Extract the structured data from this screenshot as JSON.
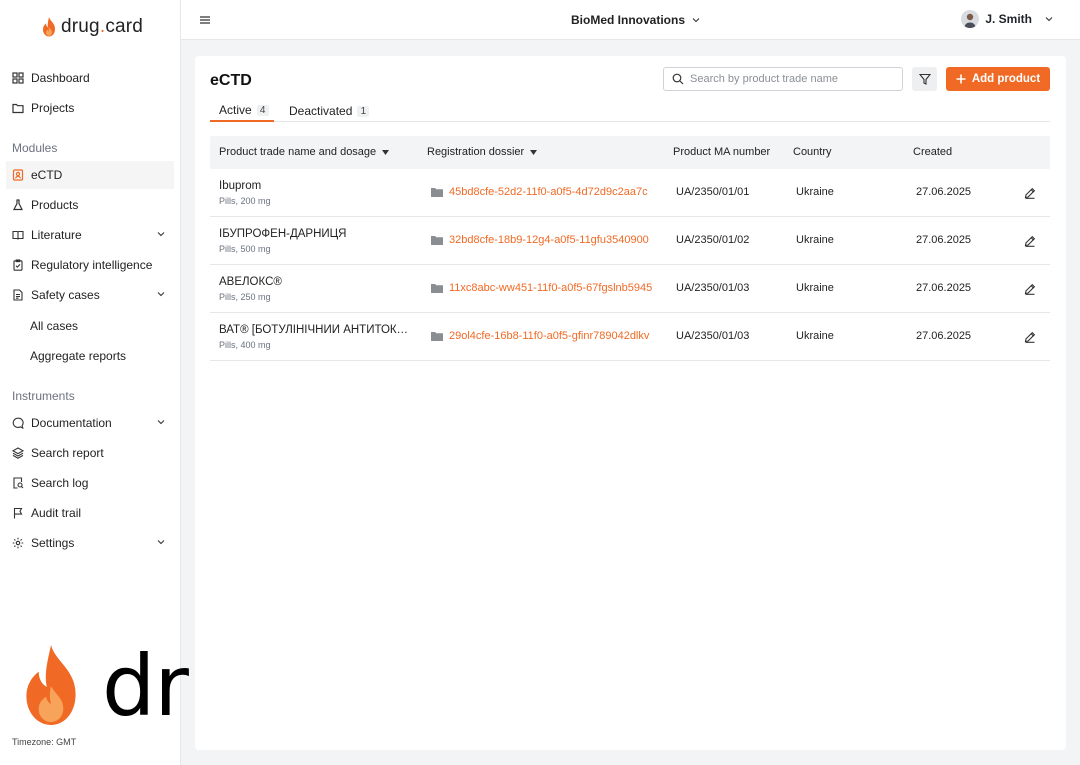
{
  "brand": {
    "name_part1": "drug",
    "name_dot": ".",
    "name_part2": "card",
    "accent": "#f06a25"
  },
  "sidebar": {
    "items": [
      {
        "label": "Dashboard",
        "icon": "grid-icon"
      },
      {
        "label": "Projects",
        "icon": "folder-icon"
      }
    ],
    "modules_label": "Modules",
    "modules": [
      {
        "label": "eCTD",
        "icon": "ectd-icon",
        "active": true
      },
      {
        "label": "Products",
        "icon": "flask-icon"
      },
      {
        "label": "Literature",
        "icon": "book-icon"
      },
      {
        "label": "Regulatory intelligence",
        "icon": "clipboard-check-icon"
      },
      {
        "label": "Safety cases",
        "icon": "document-icon"
      }
    ],
    "safety_sub": [
      "All cases",
      "Aggregate reports"
    ],
    "instruments_label": "Instruments",
    "instruments": [
      {
        "label": "Documentation",
        "icon": "chat-icon"
      },
      {
        "label": "Search report",
        "icon": "layers-icon"
      },
      {
        "label": "Search log",
        "icon": "search-doc-icon"
      },
      {
        "label": "Audit trail",
        "icon": "flag-icon"
      },
      {
        "label": "Settings",
        "icon": "gear-icon"
      }
    ],
    "timezone": "Timezone: GMT"
  },
  "header": {
    "org": "BioMed Innovations",
    "user": "J. Smith"
  },
  "page": {
    "title": "eCTD",
    "search_placeholder": "Search by product trade name",
    "add_label": "Add product",
    "tabs": [
      {
        "label": "Active",
        "count": "4"
      },
      {
        "label": "Deactivated",
        "count": "1"
      }
    ],
    "columns": [
      "Product trade name and dosage",
      "Registration dossier",
      "Product MA number",
      "Country",
      "Created"
    ],
    "rows": [
      {
        "name": "Ibuprom",
        "dose": "Pills, 200 mg",
        "dossier": "45bd8cfe-52d2-11f0-a0f5-4d72d9c2aa7c",
        "ma": "UA/2350/01/01",
        "country": "Ukraine",
        "created": "27.06.2025"
      },
      {
        "name": "ІБУПРОФЕН-ДАРНИЦЯ",
        "dose": "Pills, 500 mg",
        "dossier": "32bd8cfe-18b9-12g4-a0f5-11gfu3540900",
        "ma": "UA/2350/01/02",
        "country": "Ukraine",
        "created": "27.06.2025"
      },
      {
        "name": "АВЕЛОКС®",
        "dose": "Pills, 250 mg",
        "dossier": "11xc8abc-ww451-11f0-a0f5-67fgslnb5945",
        "ma": "UA/2350/01/03",
        "country": "Ukraine",
        "created": "27.06.2025"
      },
      {
        "name": "ВАТ® [БОТУЛІНІЧНИЙ АНТИТОКСИН Г…",
        "dose": "Pills, 400 mg",
        "dossier": "29ol4cfe-16b8-11f0-a0f5-gfinr789042dlkv",
        "ma": "UA/2350/01/03",
        "country": "Ukraine",
        "created": "27.06.2025"
      }
    ]
  }
}
